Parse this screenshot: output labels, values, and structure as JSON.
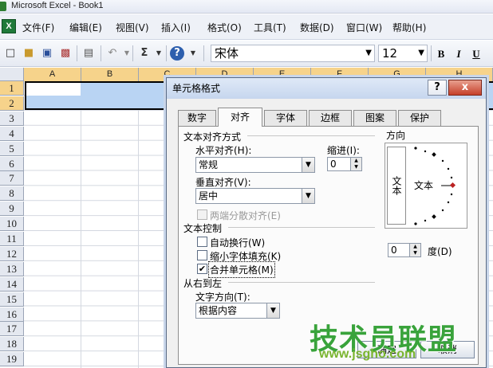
{
  "window": {
    "title": "Microsoft Excel - Book1"
  },
  "menu": {
    "items": [
      "文件(F)",
      "编辑(E)",
      "视图(V)",
      "插入(I)",
      "格式(O)",
      "工具(T)",
      "数据(D)",
      "窗口(W)",
      "帮助(H)"
    ]
  },
  "toolbar": {
    "sum_label": "Σ",
    "font_name": "宋体",
    "font_size": "12",
    "bold": "B",
    "italic": "I",
    "underline": "U"
  },
  "sheet": {
    "columns": [
      "A",
      "B",
      "C",
      "D",
      "E",
      "F",
      "G",
      "H"
    ],
    "rows": [
      "1",
      "2",
      "3",
      "4",
      "5",
      "6",
      "7",
      "8",
      "9",
      "10",
      "11",
      "12",
      "13",
      "14",
      "15",
      "16",
      "17",
      "18",
      "19"
    ],
    "selected_rows": [
      "1",
      "2"
    ],
    "selection_color": "#b9d4f3",
    "header_highlight_color": "#f6d38b"
  },
  "dialog": {
    "title": "单元格格式",
    "help": "?",
    "close": "x",
    "tabs": [
      "数字",
      "对齐",
      "字体",
      "边框",
      "图案",
      "保护"
    ],
    "active_tab": "对齐",
    "text_alignment": {
      "section": "文本对齐方式",
      "horizontal_label": "水平对齐(H):",
      "horizontal_value": "常规",
      "indent_label": "缩进(I):",
      "indent_value": "0",
      "vertical_label": "垂直对齐(V):",
      "vertical_value": "居中",
      "distributed_label": "两端分散对齐(E)"
    },
    "text_control": {
      "section": "文本控制",
      "wrap_text": "自动换行(W)",
      "wrap_checked": false,
      "shrink_to_fit": "缩小字体填充(K)",
      "shrink_checked": false,
      "merge_cells": "合并单元格(M)",
      "merge_checked": true
    },
    "rtl": {
      "section": "从右到左",
      "direction_label": "文字方向(T):",
      "direction_value": "根据内容"
    },
    "orientation": {
      "section": "方向",
      "vertical_text": "文本",
      "dial_text": "文本",
      "degree_value": "0",
      "degree_label": "度(D)"
    },
    "buttons": {
      "ok": "确定",
      "cancel": "取消"
    }
  },
  "watermark": {
    "text": "技术员联盟",
    "url": "www.jsgho.com"
  }
}
